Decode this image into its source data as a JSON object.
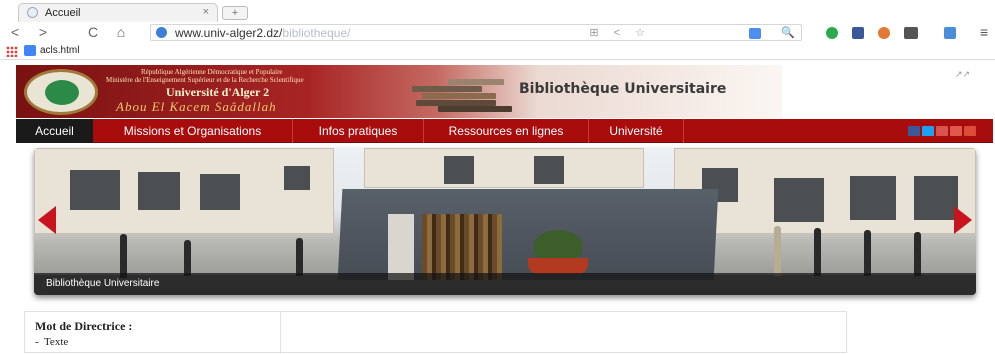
{
  "browser": {
    "tab_title": "Accueil",
    "tab_close": "×",
    "new_tab": "+",
    "url_host": "www.univ-alger2.dz/",
    "url_path": "bibliotheque/",
    "nav_back": "<",
    "nav_forward": ">",
    "nav_reload": "C",
    "nav_home": "⌂",
    "omni_actions": "⊞ < ☆",
    "zoom": "🔍",
    "menu": "≡",
    "bookmark_label": "acls.html"
  },
  "header": {
    "line1": "République Algérienne Démocratique et Populaire",
    "line2": "Ministère de l'Enseignement Supérieur et de la Recherche Scientifique",
    "university": "Université d'Alger 2",
    "script_name": "Abou El Kacem Saâdallah",
    "site_title": "Bibliothèque Universitaire",
    "share_mini": "↗↗"
  },
  "nav": {
    "items": [
      {
        "label": "Accueil"
      },
      {
        "label": "Missions et Organisations"
      },
      {
        "label": "Infos pratiques"
      },
      {
        "label": "Ressources en lignes"
      },
      {
        "label": "Université"
      }
    ]
  },
  "slider": {
    "caption": "Bibliothèque Universitaire"
  },
  "panel": {
    "title": "Mot de Directrice :",
    "item": "Texte",
    "bullet": "-"
  },
  "colors": {
    "nav_red": "#a80c0c",
    "nav_active": "#1a1a1a",
    "slider_arrow": "#c8141e"
  }
}
